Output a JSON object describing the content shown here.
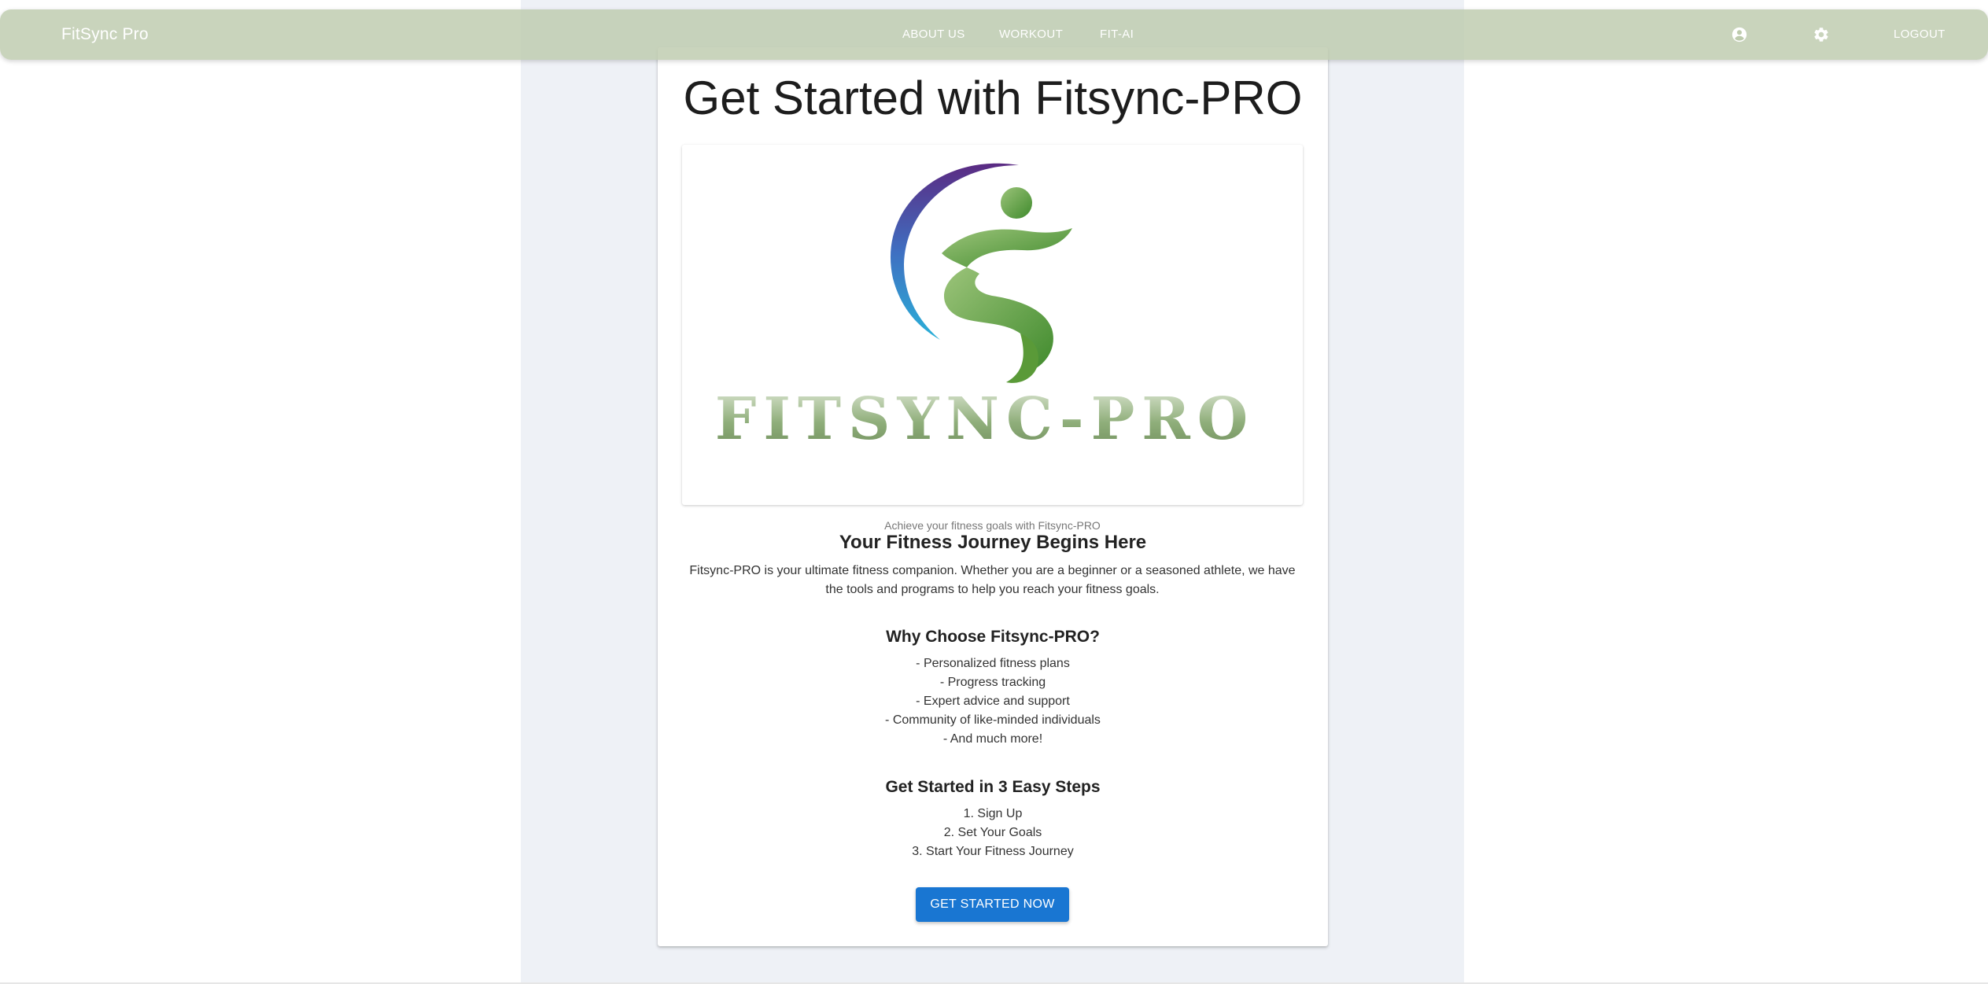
{
  "app": {
    "brand": "FitSync Pro"
  },
  "nav": {
    "about": "ABOUT US",
    "workout": "WORKOUT",
    "fitai": "FIT-AI",
    "logout": "LOGOUT",
    "account_icon": "account-circle-icon",
    "settings_icon": "gear-icon"
  },
  "main": {
    "title": "Get Started with Fitsync-PRO",
    "logo_wordmark": "FITSYNC-PRO",
    "image_caption": "Achieve your fitness goals with Fitsync-PRO",
    "journey_title": "Your Fitness Journey Begins Here",
    "journey_text_line1": "Fitsync-PRO is your ultimate fitness companion. Whether you are a beginner or a seasoned athlete, we have",
    "journey_text_line2": "the tools and programs to help you reach your fitness goals.",
    "why_title": "Why Choose Fitsync-PRO?",
    "features": [
      "- Personalized fitness plans",
      "- Progress tracking",
      "- Expert advice and support",
      "- Community of like-minded individuals",
      "- And much more!"
    ],
    "steps_title": "Get Started in 3 Easy Steps",
    "steps": [
      "1. Sign Up",
      "2. Set Your Goals",
      "3. Start Your Fitness Journey"
    ],
    "cta_label": "GET STARTED NOW"
  },
  "colors": {
    "topbar": "#bdcbad",
    "primary_button": "#1976d2",
    "page_column": "#eef1f6",
    "logo_green": "#5f9a3c",
    "logo_purple": "#5b2a82",
    "logo_blue": "#2aa8d8"
  }
}
